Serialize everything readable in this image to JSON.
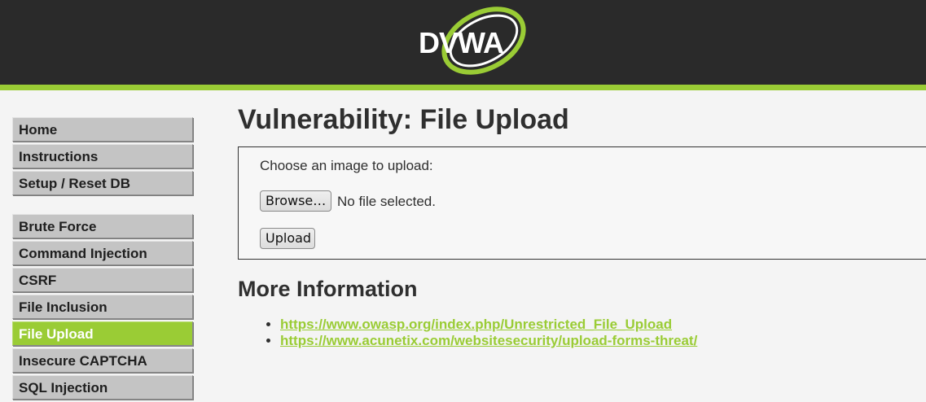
{
  "header": {
    "logo_text": "DVWA"
  },
  "sidebar": {
    "groups": [
      [
        {
          "label": "Home"
        },
        {
          "label": "Instructions"
        },
        {
          "label": "Setup / Reset DB"
        }
      ],
      [
        {
          "label": "Brute Force"
        },
        {
          "label": "Command Injection"
        },
        {
          "label": "CSRF"
        },
        {
          "label": "File Inclusion"
        },
        {
          "label": "File Upload",
          "selected": true
        },
        {
          "label": "Insecure CAPTCHA"
        },
        {
          "label": "SQL Injection"
        }
      ]
    ]
  },
  "main": {
    "title": "Vulnerability: File Upload",
    "upload": {
      "prompt": "Choose an image to upload:",
      "browse_label": "Browse…",
      "file_status": "No file selected.",
      "upload_label": "Upload"
    },
    "more_info": {
      "heading": "More Information",
      "links": [
        "https://www.owasp.org/index.php/Unrestricted_File_Upload",
        "https://www.acunetix.com/websitesecurity/upload-forms-threat/"
      ]
    }
  },
  "colors": {
    "accent": "#9acc35",
    "header_bg": "#2a2a2a",
    "page_bg": "#f4f4f4"
  }
}
